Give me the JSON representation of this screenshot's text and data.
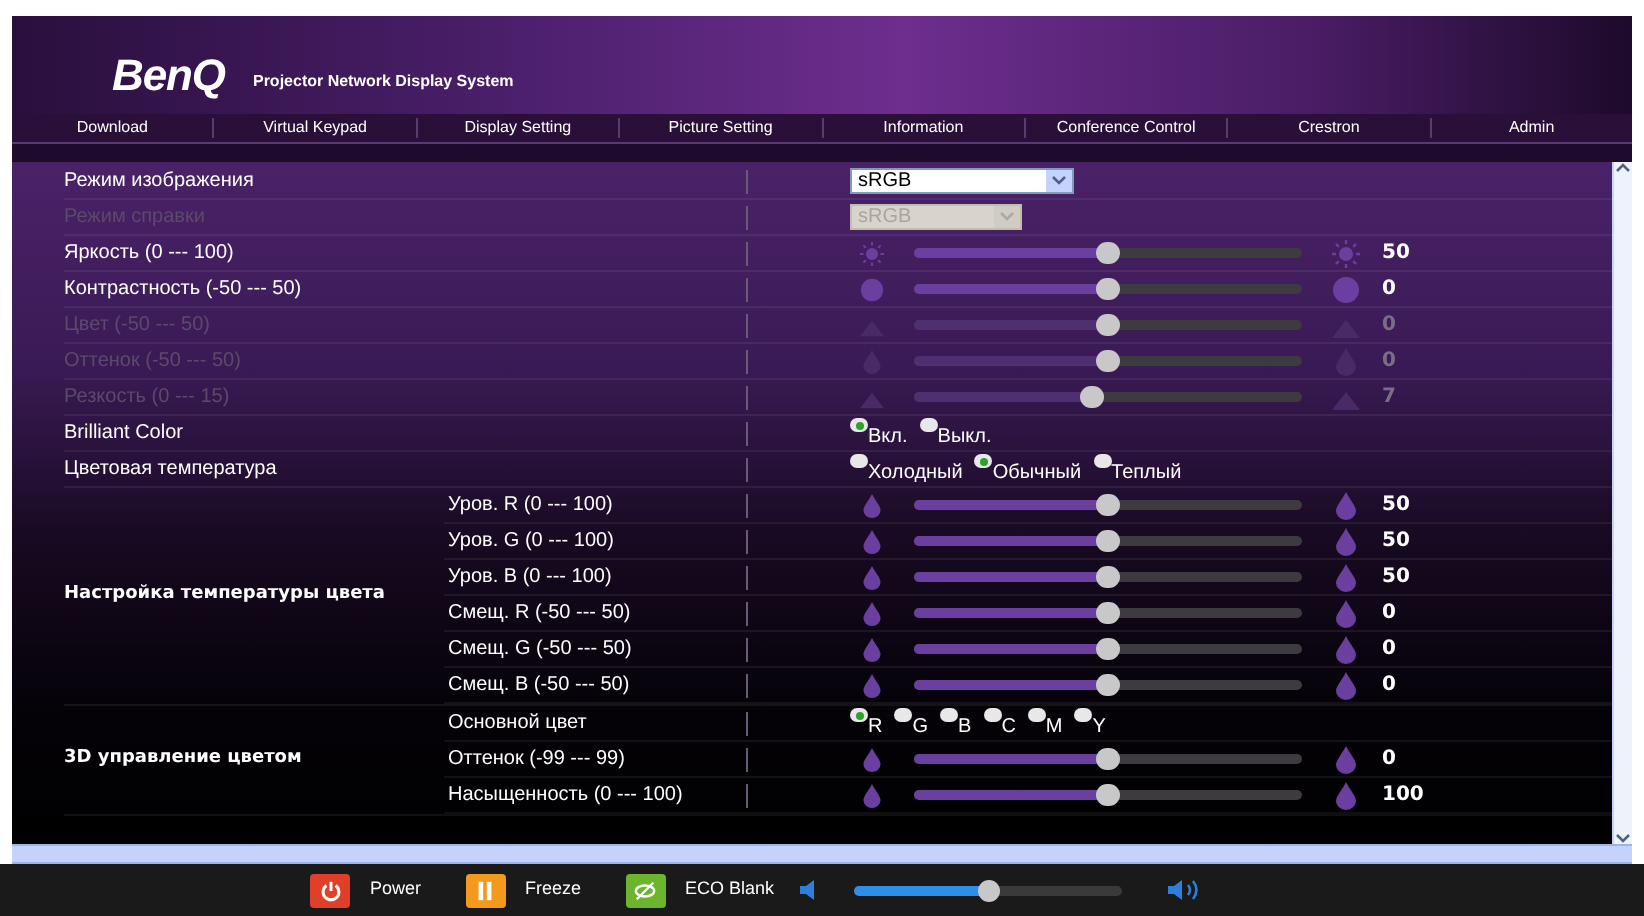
{
  "header": {
    "logo": "BenQ",
    "title": "Projector Network Display System"
  },
  "nav": [
    {
      "label": "Download"
    },
    {
      "label": "Virtual Keypad"
    },
    {
      "label": "Display Setting"
    },
    {
      "label": "Picture Setting"
    },
    {
      "label": "Information"
    },
    {
      "label": "Conference Control"
    },
    {
      "label": "Crestron"
    },
    {
      "label": "Admin"
    }
  ],
  "rows": [
    {
      "kind": "select",
      "label": "Режим изображения",
      "value": "sRGB",
      "disabled": false
    },
    {
      "kind": "select",
      "label": "Режим справки",
      "value": "sRGB",
      "disabled": true
    },
    {
      "kind": "slider",
      "label": "Яркость (0 --- 100)",
      "level": 0.5,
      "reading": "50",
      "disabled": false
    },
    {
      "kind": "slider",
      "label": "Контрастность (-50 --- 50)",
      "level": 0.5,
      "reading": "0",
      "disabled": false
    },
    {
      "kind": "slider",
      "label": "Цвет (-50 --- 50)",
      "level": 0.5,
      "reading": "0",
      "disabled": true
    },
    {
      "kind": "slider",
      "label": "Оттенок (-50 --- 50)",
      "level": 0.5,
      "reading": "0",
      "disabled": true
    },
    {
      "kind": "slider",
      "label": "Резкость (0 --- 15)",
      "level": 0.46,
      "reading": "7",
      "disabled": true
    },
    {
      "kind": "radio",
      "label": "Brilliant Color",
      "options": [
        {
          "label": "Вкл.",
          "selected": true
        },
        {
          "label": "Выкл.",
          "selected": false
        }
      ]
    },
    {
      "kind": "radio",
      "label": "Цветовая температура",
      "options": [
        {
          "label": "Холодный",
          "selected": false
        },
        {
          "label": "Обычный",
          "selected": true
        },
        {
          "label": "Теплый",
          "selected": false
        }
      ]
    },
    {
      "kind": "group",
      "label": "Настройка температуры цвета",
      "children": [
        {
          "kind": "slider",
          "label": "Уров. R (0 --- 100)",
          "level": 0.5,
          "reading": "50",
          "disabled": false
        },
        {
          "kind": "slider",
          "label": "Уров. G (0 --- 100)",
          "level": 0.5,
          "reading": "50",
          "disabled": false
        },
        {
          "kind": "slider",
          "label": "Уров. B (0 --- 100)",
          "level": 0.5,
          "reading": "50",
          "disabled": false
        },
        {
          "kind": "slider",
          "label": "Смещ. R (-50 --- 50)",
          "level": 0.5,
          "reading": "0",
          "disabled": false
        },
        {
          "kind": "slider",
          "label": "Смещ. G (-50 --- 50)",
          "level": 0.5,
          "reading": "0",
          "disabled": false
        },
        {
          "kind": "slider",
          "label": "Смещ. B (-50 --- 50)",
          "level": 0.5,
          "reading": "0",
          "disabled": false
        }
      ]
    },
    {
      "kind": "group",
      "label": "3D управление цветом",
      "children": [
        {
          "kind": "radio",
          "label": "Основной цвет",
          "options": [
            {
              "label": "R",
              "selected": true
            },
            {
              "label": "G",
              "selected": false
            },
            {
              "label": "B",
              "selected": false
            },
            {
              "label": "C",
              "selected": false
            },
            {
              "label": "M",
              "selected": false
            },
            {
              "label": "Y",
              "selected": false
            }
          ]
        },
        {
          "kind": "slider",
          "label": "Оттенок (-99 --- 99)",
          "level": 0.5,
          "reading": "0",
          "disabled": false
        },
        {
          "kind": "slider",
          "label": "Насыщенность (0 --- 100)",
          "level": 0.5,
          "reading": "100",
          "disabled": false
        }
      ]
    }
  ],
  "footer": {
    "buttons": [
      {
        "kind": "power",
        "label": "Power"
      },
      {
        "kind": "freeze",
        "label": "Freeze"
      },
      {
        "kind": "eco",
        "label": "ECO Blank"
      }
    ],
    "volume": {
      "level": 0.5
    }
  }
}
